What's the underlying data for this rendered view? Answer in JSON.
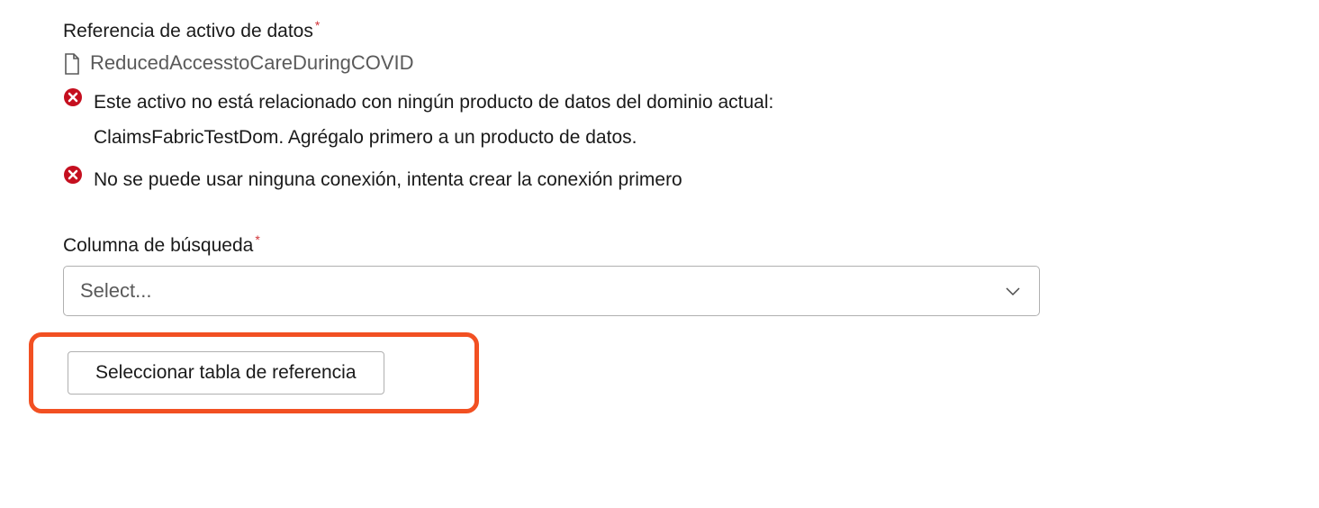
{
  "labels": {
    "asset_reference": "Referencia de activo de datos",
    "lookup_column": "Columna de búsqueda"
  },
  "asset": {
    "name": "ReducedAccesstoCareDuringCOVID"
  },
  "errors": [
    {
      "text": "Este activo no está relacionado con ningún producto de datos del dominio actual: ClaimsFabricTestDom. Agrégalo primero a un producto de datos."
    },
    {
      "text": "No se puede usar ninguna conexión, intenta crear la conexión primero"
    }
  ],
  "select": {
    "placeholder": "Select..."
  },
  "buttons": {
    "select_reference_table": "Seleccionar tabla de referencia"
  },
  "colors": {
    "error": "#c50f1f",
    "highlight": "#f25022"
  }
}
